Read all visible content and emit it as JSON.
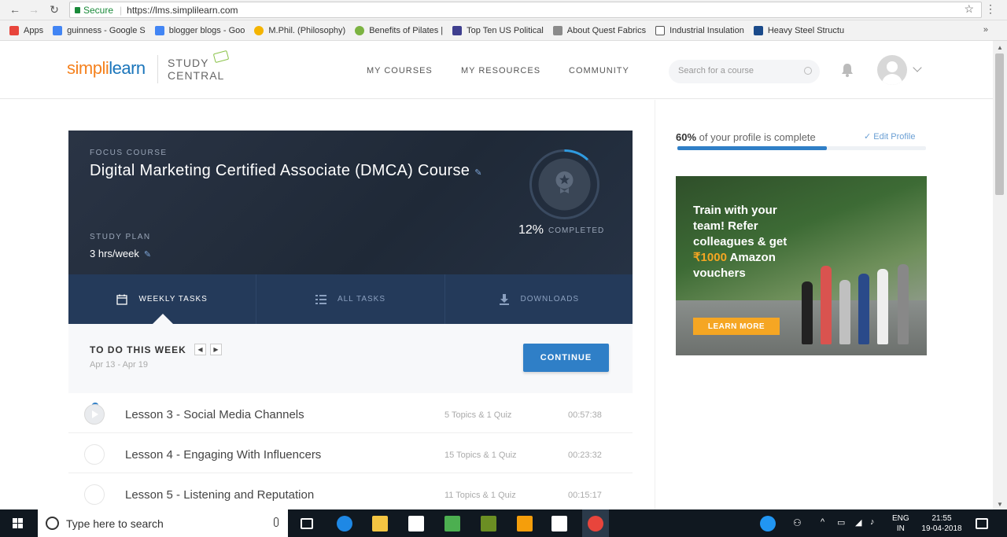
{
  "browser": {
    "secure_label": "Secure",
    "url": "https://lms.simplilearn.com",
    "bookmarks": [
      {
        "label": "Apps",
        "color": "#e8453c"
      },
      {
        "label": "guinness - Google S",
        "color": "#4285f4"
      },
      {
        "label": "blogger blogs - Goo",
        "color": "#4285f4"
      },
      {
        "label": "M.Phil. (Philosophy)",
        "color": "#f4b400"
      },
      {
        "label": "Benefits of Pilates |",
        "color": "#7cb342"
      },
      {
        "label": "Top Ten US Political",
        "color": "#3f3f8f"
      },
      {
        "label": "About Quest Fabrics",
        "color": "#8a8a8a"
      },
      {
        "label": "Industrial Insulation",
        "color": "#ffffff"
      },
      {
        "label": "Heavy Steel Structu",
        "color": "#1a4a8a"
      }
    ],
    "bookmarks_more": "»"
  },
  "header": {
    "logo_simpl": "simpl",
    "logo_i": "i",
    "logo_learn": "learn",
    "study_line1": "STUDY",
    "study_line2": "CENTRAL",
    "nav": [
      "MY COURSES",
      "MY RESOURCES",
      "COMMUNITY"
    ],
    "search_placeholder": "Search for a course"
  },
  "focus": {
    "label": "FOCUS COURSE",
    "title": "Digital Marketing Certified Associate (DMCA) Course",
    "plan_label": "STUDY PLAN",
    "plan_value": "3 hrs/week",
    "percent": "12%",
    "percent_label": "COMPLETED",
    "progress": 0.12
  },
  "tabs": [
    {
      "label": "WEEKLY TASKS",
      "icon": "calendar-icon",
      "active": true
    },
    {
      "label": "ALL TASKS",
      "icon": "list-icon",
      "active": false
    },
    {
      "label": "DOWNLOADS",
      "icon": "download-icon",
      "active": false
    }
  ],
  "week": {
    "title": "TO DO THIS WEEK",
    "dates": "Apr 13 - Apr 19",
    "continue_label": "CONTINUE"
  },
  "lessons": [
    {
      "title": "Lesson 3 - Social Media Channels",
      "topics": "5 Topics & 1 Quiz",
      "time": "00:57:38"
    },
    {
      "title": "Lesson 4 - Engaging With Influencers",
      "topics": "15 Topics & 1 Quiz",
      "time": "00:23:32"
    },
    {
      "title": "Lesson 5 - Listening and Reputation",
      "topics": "11 Topics & 1 Quiz",
      "time": "00:15:17"
    }
  ],
  "profile": {
    "percent": "60%",
    "text": "of your profile is complete",
    "edit_label": "✓ Edit Profile",
    "progress": 0.6
  },
  "promo": {
    "line1": "Train with your",
    "line2": "team! Refer",
    "line3": "colleagues & get",
    "amount": "₹1000",
    "line4_rest": " Amazon",
    "line5": "vouchers",
    "cta": "LEARN MORE"
  },
  "taskbar": {
    "search_placeholder": "Type here to search",
    "lang1": "ENG",
    "lang2": "IN",
    "time": "21:55",
    "date": "19-04-2018"
  },
  "colors": {
    "brand_orange": "#f5821f",
    "brand_blue": "#1a75bb",
    "accent": "#2f7fc7",
    "card_dark": "#2a3445",
    "tabs_bg": "#243a5a"
  }
}
